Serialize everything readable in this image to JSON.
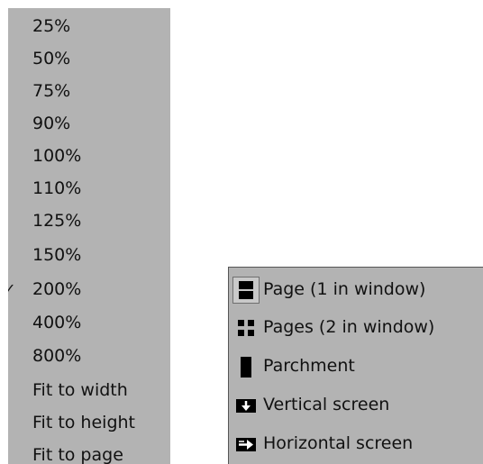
{
  "zoom_menu": {
    "items": [
      {
        "label": "25%",
        "checked": false
      },
      {
        "label": "50%",
        "checked": false
      },
      {
        "label": "75%",
        "checked": false
      },
      {
        "label": "90%",
        "checked": false
      },
      {
        "label": "100%",
        "checked": false
      },
      {
        "label": "110%",
        "checked": false
      },
      {
        "label": "125%",
        "checked": false
      },
      {
        "label": "150%",
        "checked": false
      },
      {
        "label": "200%",
        "checked": true
      },
      {
        "label": "400%",
        "checked": false
      },
      {
        "label": "800%",
        "checked": false
      },
      {
        "label": "Fit to width",
        "checked": false
      },
      {
        "label": "Fit to height",
        "checked": false
      },
      {
        "label": "Fit to page",
        "checked": false
      }
    ],
    "check_glyph": "✓"
  },
  "view_menu": {
    "items": [
      {
        "label": "Page (1 in window)",
        "icon": "single-page-icon",
        "selected": true
      },
      {
        "label": "Pages (2 in window)",
        "icon": "two-pages-icon",
        "selected": false
      },
      {
        "label": "Parchment",
        "icon": "parchment-icon",
        "selected": false
      },
      {
        "label": "Vertical screen",
        "icon": "vertical-screen-icon",
        "selected": false
      },
      {
        "label": "Horizontal screen",
        "icon": "horizontal-screen-icon",
        "selected": false
      }
    ]
  },
  "colors": {
    "menu_bg": "#b3b3b3",
    "text": "#111111",
    "border": "#555555",
    "icon": "#000000"
  }
}
